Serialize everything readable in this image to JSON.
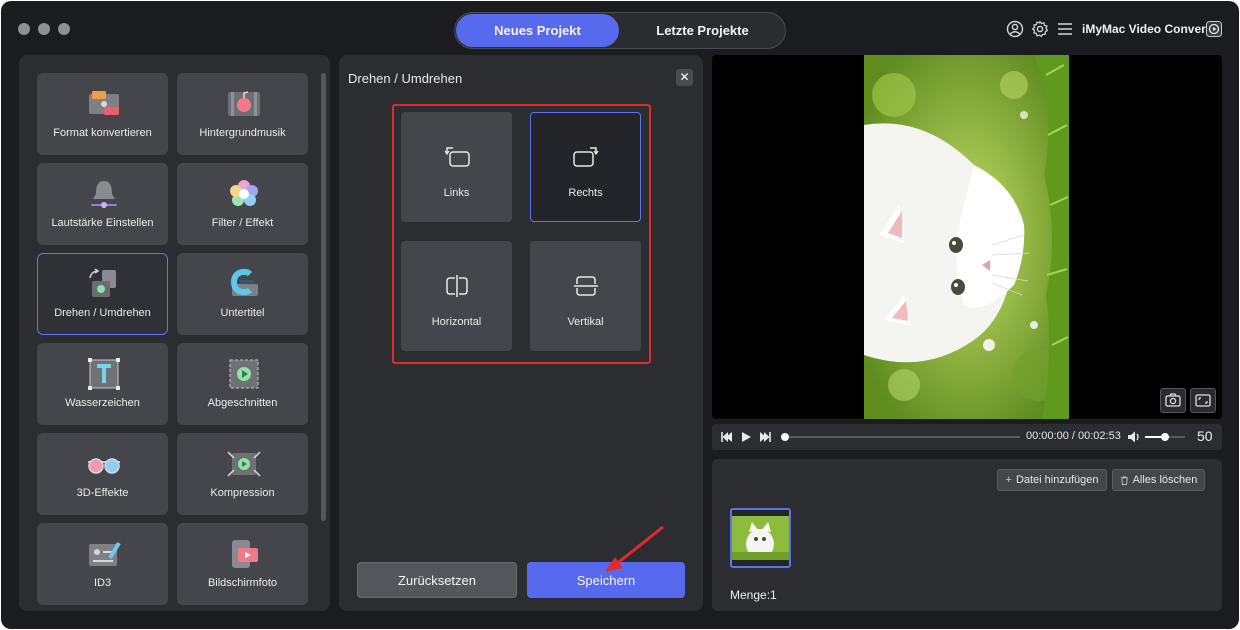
{
  "header": {
    "tabs": [
      {
        "label": "Neues Projekt",
        "active": true
      },
      {
        "label": "Letzte Projekte",
        "active": false
      }
    ],
    "app_name": "iMyMac Video Converter"
  },
  "tools": [
    {
      "label": "Format konvertieren",
      "icon": "format-convert-icon"
    },
    {
      "label": "Hintergrundmusik",
      "icon": "background-music-icon"
    },
    {
      "label": "Lautstärke Einstellen",
      "icon": "volume-bell-icon"
    },
    {
      "label": "Filter / Effekt",
      "icon": "filter-flower-icon"
    },
    {
      "label": "Drehen / Umdrehen",
      "icon": "rotate-icon",
      "selected": true
    },
    {
      "label": "Untertitel",
      "icon": "subtitle-icon"
    },
    {
      "label": "Wasserzeichen",
      "icon": "watermark-icon"
    },
    {
      "label": "Abgeschnitten",
      "icon": "crop-icon"
    },
    {
      "label": "3D-Effekte",
      "icon": "3d-glasses-icon"
    },
    {
      "label": "Kompression",
      "icon": "compression-icon"
    },
    {
      "label": "ID3",
      "icon": "id3-tag-icon"
    },
    {
      "label": "Bildschirmfoto",
      "icon": "screenshot-icon"
    }
  ],
  "rotate_panel": {
    "title": "Drehen / Umdrehen",
    "options": [
      {
        "label": "Links",
        "icon": "rotate-left-icon"
      },
      {
        "label": "Rechts",
        "icon": "rotate-right-icon",
        "selected": true
      },
      {
        "label": "Horizontal",
        "icon": "flip-horizontal-icon"
      },
      {
        "label": "Vertikal",
        "icon": "flip-vertical-icon"
      }
    ],
    "reset_label": "Zurücksetzen",
    "save_label": "Speichern"
  },
  "player": {
    "timecode": "00:00:00 / 00:02:53",
    "volume": "50",
    "progress": 0
  },
  "files": {
    "add_label": "Datei hinzufügen",
    "clear_label": "Alles löschen",
    "count_label": "Menge:1"
  },
  "colors": {
    "accent": "#5769ec",
    "highlight": "#e02a2f",
    "panel": "#2c2d31",
    "tile": "#45464b"
  }
}
